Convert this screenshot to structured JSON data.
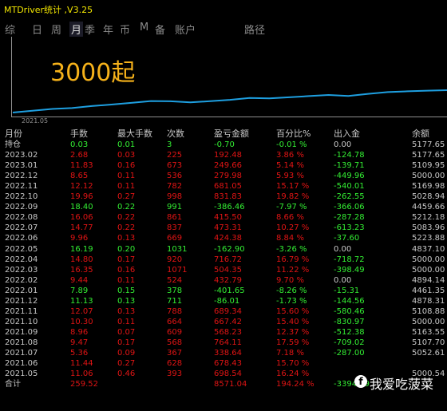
{
  "window": {
    "title": "MTDriver统计 ,V3.25"
  },
  "tabs": [
    "综",
    "日",
    "周",
    "月",
    "季",
    "年",
    "币",
    "M",
    "备",
    "账户",
    "路径"
  ],
  "chart": {
    "label": "3000起",
    "x_tick": "2021.05"
  },
  "table": {
    "headers": [
      "月份",
      "手数",
      "最大手数",
      "次数",
      "盈亏金额",
      "百分比%",
      "出入金",
      "余额"
    ],
    "rows": [
      {
        "month": "持仓",
        "lots": "0.03",
        "max_lots": "0.01",
        "count": "3",
        "pnl": "-0.70",
        "pct": "-0.01 %",
        "flow": "0.00",
        "balance": "5177.65",
        "sign": "neg",
        "flow_sign": "neu"
      },
      {
        "month": "2023.02",
        "lots": "2.68",
        "max_lots": "0.03",
        "count": "225",
        "pnl": "192.48",
        "pct": "3.86 %",
        "flow": "-124.78",
        "balance": "5177.65",
        "sign": "pos",
        "flow_sign": "neg"
      },
      {
        "month": "2023.01",
        "lots": "11.83",
        "max_lots": "0.16",
        "count": "673",
        "pnl": "249.66",
        "pct": "5.14 %",
        "flow": "-139.71",
        "balance": "5109.95",
        "sign": "pos",
        "flow_sign": "neg"
      },
      {
        "month": "2022.12",
        "lots": "8.65",
        "max_lots": "0.11",
        "count": "536",
        "pnl": "279.98",
        "pct": "5.93 %",
        "flow": "-449.96",
        "balance": "5000.00",
        "sign": "pos",
        "flow_sign": "neg"
      },
      {
        "month": "2022.11",
        "lots": "12.12",
        "max_lots": "0.11",
        "count": "782",
        "pnl": "681.05",
        "pct": "15.17 %",
        "flow": "-540.01",
        "balance": "5169.98",
        "sign": "pos",
        "flow_sign": "neg"
      },
      {
        "month": "2022.10",
        "lots": "19.96",
        "max_lots": "0.27",
        "count": "998",
        "pnl": "831.83",
        "pct": "19.82 %",
        "flow": "-262.55",
        "balance": "5028.94",
        "sign": "pos",
        "flow_sign": "neg"
      },
      {
        "month": "2022.09",
        "lots": "18.40",
        "max_lots": "0.22",
        "count": "991",
        "pnl": "-386.46",
        "pct": "-7.97 %",
        "flow": "-366.06",
        "balance": "4459.66",
        "sign": "neg",
        "flow_sign": "neg"
      },
      {
        "month": "2022.08",
        "lots": "16.06",
        "max_lots": "0.22",
        "count": "861",
        "pnl": "415.50",
        "pct": "8.66 %",
        "flow": "-287.28",
        "balance": "5212.18",
        "sign": "pos",
        "flow_sign": "neg"
      },
      {
        "month": "2022.07",
        "lots": "14.77",
        "max_lots": "0.22",
        "count": "837",
        "pnl": "473.31",
        "pct": "10.27 %",
        "flow": "-613.23",
        "balance": "5083.96",
        "sign": "pos",
        "flow_sign": "neg"
      },
      {
        "month": "2022.06",
        "lots": "9.96",
        "max_lots": "0.13",
        "count": "669",
        "pnl": "424.38",
        "pct": "8.84 %",
        "flow": "-37.60",
        "balance": "5223.88",
        "sign": "pos",
        "flow_sign": "neg"
      },
      {
        "month": "2022.05",
        "lots": "16.19",
        "max_lots": "0.20",
        "count": "1031",
        "pnl": "-162.90",
        "pct": "-3.26 %",
        "flow": "0.00",
        "balance": "4837.10",
        "sign": "neg",
        "flow_sign": "neu"
      },
      {
        "month": "2022.04",
        "lots": "14.80",
        "max_lots": "0.17",
        "count": "920",
        "pnl": "716.72",
        "pct": "16.79 %",
        "flow": "-718.72",
        "balance": "5000.00",
        "sign": "pos",
        "flow_sign": "neg"
      },
      {
        "month": "2022.03",
        "lots": "16.35",
        "max_lots": "0.16",
        "count": "1071",
        "pnl": "504.35",
        "pct": "11.22 %",
        "flow": "-398.49",
        "balance": "5000.00",
        "sign": "pos",
        "flow_sign": "neg"
      },
      {
        "month": "2022.02",
        "lots": "9.44",
        "max_lots": "0.11",
        "count": "524",
        "pnl": "432.79",
        "pct": "9.70 %",
        "flow": "0.00",
        "balance": "4894.14",
        "sign": "pos",
        "flow_sign": "neu"
      },
      {
        "month": "2022.01",
        "lots": "7.89",
        "max_lots": "0.15",
        "count": "378",
        "pnl": "-401.65",
        "pct": "-8.26 %",
        "flow": "-15.31",
        "balance": "4461.35",
        "sign": "neg",
        "flow_sign": "neg"
      },
      {
        "month": "2021.12",
        "lots": "11.13",
        "max_lots": "0.13",
        "count": "711",
        "pnl": "-86.01",
        "pct": "-1.73 %",
        "flow": "-144.56",
        "balance": "4878.31",
        "sign": "neg",
        "flow_sign": "neg"
      },
      {
        "month": "2021.11",
        "lots": "12.07",
        "max_lots": "0.13",
        "count": "788",
        "pnl": "689.34",
        "pct": "15.60 %",
        "flow": "-580.46",
        "balance": "5108.88",
        "sign": "pos",
        "flow_sign": "neg"
      },
      {
        "month": "2021.10",
        "lots": "10.30",
        "max_lots": "0.11",
        "count": "664",
        "pnl": "667.42",
        "pct": "15.40 %",
        "flow": "-830.97",
        "balance": "5000.00",
        "sign": "pos",
        "flow_sign": "neg"
      },
      {
        "month": "2021.09",
        "lots": "8.96",
        "max_lots": "0.07",
        "count": "609",
        "pnl": "568.23",
        "pct": "12.37 %",
        "flow": "-512.38",
        "balance": "5163.55",
        "sign": "pos",
        "flow_sign": "neg"
      },
      {
        "month": "2021.08",
        "lots": "9.47",
        "max_lots": "0.17",
        "count": "568",
        "pnl": "764.11",
        "pct": "17.59 %",
        "flow": "-709.02",
        "balance": "5107.70",
        "sign": "pos",
        "flow_sign": "neg"
      },
      {
        "month": "2021.07",
        "lots": "5.36",
        "max_lots": "0.09",
        "count": "367",
        "pnl": "338.64",
        "pct": "7.18 %",
        "flow": "-287.00",
        "balance": "5052.61",
        "sign": "pos",
        "flow_sign": "neg"
      },
      {
        "month": "2021.06",
        "lots": "11.44",
        "max_lots": "0.27",
        "count": "628",
        "pnl": "678.43",
        "pct": "15.70 %",
        "flow": "",
        "balance": "",
        "sign": "pos",
        "flow_sign": "neg"
      },
      {
        "month": "2021.05",
        "lots": "11.06",
        "max_lots": "0.46",
        "count": "393",
        "pnl": "698.54",
        "pct": "16.24 %",
        "flow": "",
        "balance": "5000.54",
        "sign": "pos",
        "flow_sign": "neg"
      }
    ],
    "total": {
      "month": "合计",
      "lots": "259.52",
      "pnl": "8571.04",
      "pct": "194.24 %",
      "flow": "-3394.09"
    }
  },
  "watermark": {
    "logo": "f",
    "text": "我爱吃菠菜"
  },
  "colors": {
    "positive": "#e01414",
    "negative": "#33ee33",
    "neutral": "#c8c8c8",
    "title": "#f2e600",
    "chart_line": "#1e9fe0",
    "big_label": "#f6b21a"
  }
}
